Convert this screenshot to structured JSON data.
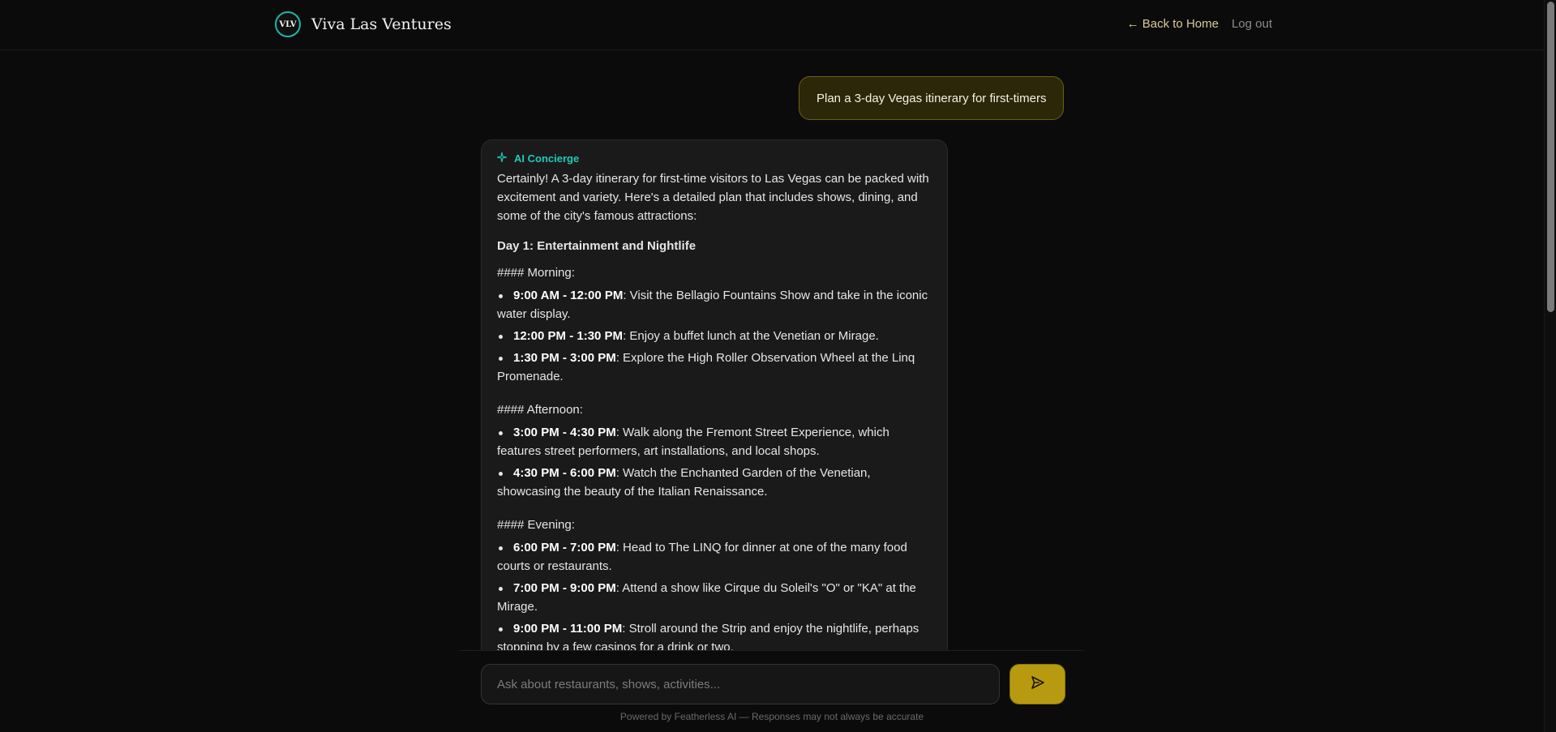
{
  "header": {
    "logo_text": "VLV",
    "brand": "Viva Las Ventures",
    "nav": {
      "back_home": "← Back to Home",
      "logout": "Log out"
    }
  },
  "chat": {
    "user_message": "Plan a 3-day Vegas itinerary for first-timers",
    "ai": {
      "label": "AI Concierge",
      "sparkle_icon": "sparkle-icon",
      "intro": "Certainly! A 3-day itinerary for first-time visitors to Las Vegas can be packed with excitement and variety. Here's a detailed plan that includes shows, dining, and some of the city's famous attractions:",
      "day_title": "Day 1: Entertainment and Nightlife",
      "sections": [
        {
          "heading": "#### Morning:",
          "items": [
            {
              "time": "9:00 AM - 12:00 PM",
              "text": ": Visit the Bellagio Fountains Show and take in the iconic water display."
            },
            {
              "time": "12:00 PM - 1:30 PM",
              "text": ": Enjoy a buffet lunch at the Venetian or Mirage."
            },
            {
              "time": "1:30 PM - 3:00 PM",
              "text": ": Explore the High Roller Observation Wheel at the Linq Promenade."
            }
          ]
        },
        {
          "heading": "#### Afternoon:",
          "items": [
            {
              "time": "3:00 PM - 4:30 PM",
              "text": ": Walk along the Fremont Street Experience, which features street performers, art installations, and local shops."
            },
            {
              "time": "4:30 PM - 6:00 PM",
              "text": ": Watch the Enchanted Garden of the Venetian, showcasing the beauty of the Italian Renaissance."
            }
          ]
        },
        {
          "heading": "#### Evening:",
          "items": [
            {
              "time": "6:00 PM - 7:00 PM",
              "text": ": Head to The LINQ for dinner at one of the many food courts or restaurants."
            },
            {
              "time": "7:00 PM - 9:00 PM",
              "text": ": Attend a show like Cirque du Soleil's \"O\" or \"KA\" at the Mirage."
            },
            {
              "time": "9:00 PM - 11:00 PM",
              "text": ": Stroll around the Strip and enjoy the nightlife, perhaps stopping by a few casinos for a drink or two."
            }
          ]
        }
      ]
    }
  },
  "composer": {
    "placeholder": "Ask about restaurants, shows, activities...",
    "send_icon": "send-icon",
    "footnote": "Powered by Featherless AI — Responses may not always be accurate"
  },
  "colors": {
    "accent_teal": "#20c9bb",
    "accent_gold": "#b79a10",
    "user_bubble_bg": "#2c2709"
  }
}
